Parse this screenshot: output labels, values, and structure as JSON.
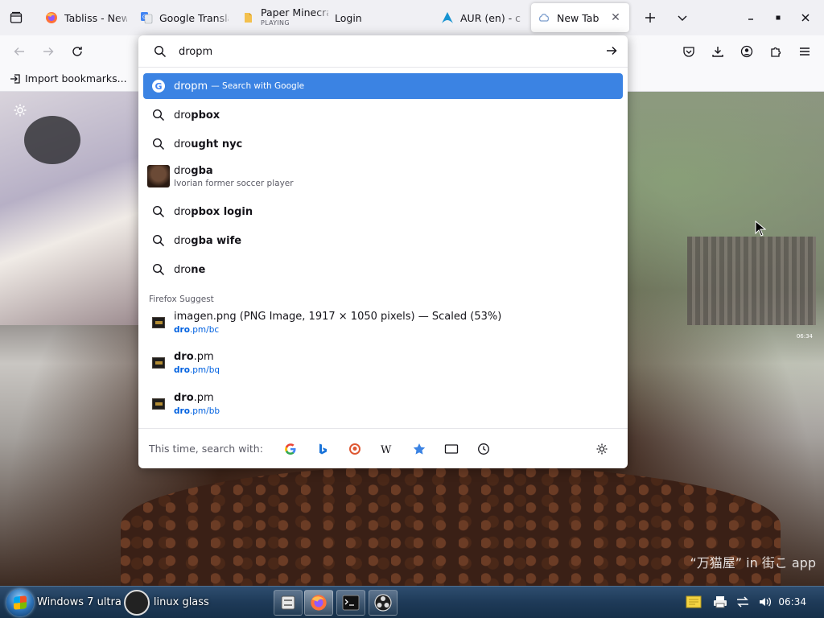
{
  "tabs": [
    {
      "title": "Tabliss - New T",
      "icon": "firefox-icon"
    },
    {
      "title": "Google Transla",
      "icon": "google-translate-icon"
    },
    {
      "title": "Paper Minecra",
      "subtitle": "PLAYING",
      "icon": "paper-icon"
    },
    {
      "title": "Login",
      "icon": "none"
    },
    {
      "title": "AUR (en) - chro",
      "icon": "arch-linux-icon"
    },
    {
      "title": "New Tab",
      "icon": "tabliss-icon"
    }
  ],
  "toolbar": {
    "bookmark_import": "Import bookmarks..."
  },
  "urlbar": {
    "value": "dropm",
    "first_result": {
      "text": "dropm",
      "hint": "— Search with Google"
    },
    "suggestions": [
      {
        "typed": "dro",
        "rest": "pbox"
      },
      {
        "typed": "dro",
        "rest": "ught nyc"
      },
      {
        "typed": "dro",
        "rest": "gba",
        "sub": "Ivorian former soccer player"
      },
      {
        "typed": "dro",
        "rest": "pbox login"
      },
      {
        "typed": "dro",
        "rest": "gba wife"
      },
      {
        "typed": "dro",
        "rest": "ne"
      }
    ],
    "section_label": "Firefox Suggest",
    "history": [
      {
        "title": "imagen.png (PNG Image, 1917 × 1050 pixels) — Scaled (53%)",
        "url_bold": "dro",
        "url_rest": ".pm/bc"
      },
      {
        "title_bold": "dro",
        "title_rest": ".pm",
        "url_bold": "dro",
        "url_rest": ".pm/bq"
      },
      {
        "title_bold": "dro",
        "title_rest": ".pm",
        "url_bold": "dro",
        "url_rest": ".pm/bb"
      }
    ],
    "oneoff_label": "This time, search with:",
    "engines": [
      "google-icon",
      "bing-icon",
      "duckduckgo-icon",
      "wikipedia-icon",
      "bookmarks-star-icon",
      "tabs-icon",
      "history-icon"
    ]
  },
  "page": {
    "clock": "06:34",
    "watermark": "“万猫屋” in 街こ app"
  },
  "taskbar": {
    "title": "Windows 7 ultra L     rch linux glass",
    "apps": [
      "file-manager-icon",
      "firefox-icon",
      "terminal-icon",
      "obs-icon"
    ],
    "clock": "06:34"
  }
}
